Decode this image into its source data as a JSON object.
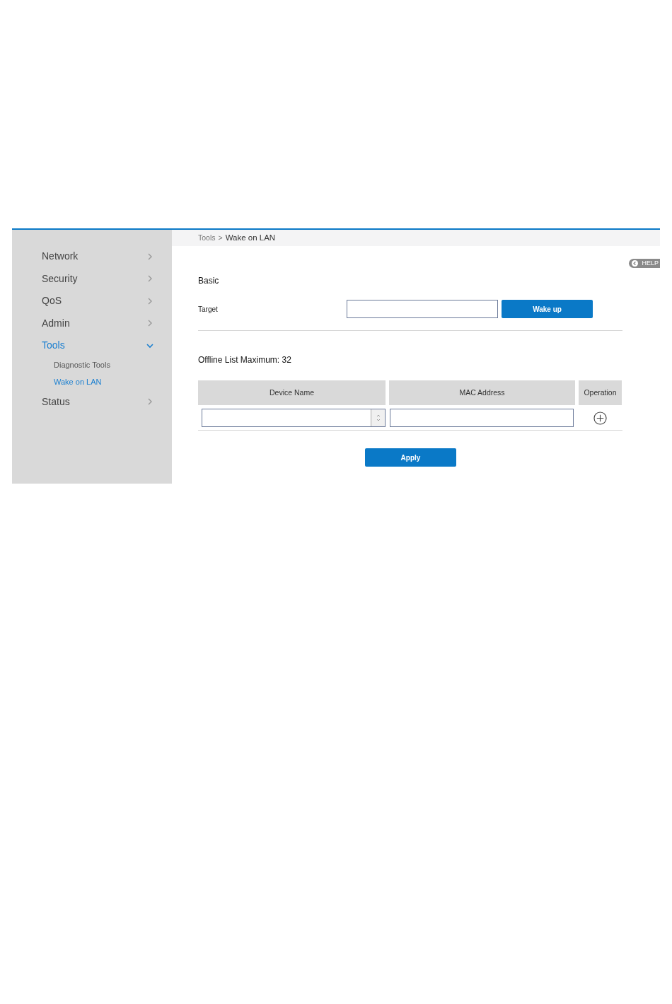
{
  "sidebar": {
    "items": [
      {
        "label": "Network",
        "expanded": false,
        "selected": false
      },
      {
        "label": "Security",
        "expanded": false,
        "selected": false
      },
      {
        "label": "QoS",
        "expanded": false,
        "selected": false
      },
      {
        "label": "Admin",
        "expanded": false,
        "selected": false
      },
      {
        "label": "Tools",
        "expanded": true,
        "selected": true,
        "children": [
          {
            "label": "Diagnostic Tools",
            "selected": false
          },
          {
            "label": "Wake on LAN",
            "selected": true
          }
        ]
      },
      {
        "label": "Status",
        "expanded": false,
        "selected": false
      }
    ]
  },
  "breadcrumb": {
    "parent": "Tools",
    "separator": ">",
    "current": "Wake on LAN"
  },
  "help_button": "HELP",
  "basic": {
    "title": "Basic",
    "target_label": "Target",
    "wake_button": "Wake up"
  },
  "offline_list": {
    "title": "Offline List Maximum: 32",
    "columns": [
      "Device Name",
      "MAC Address",
      "Operation"
    ]
  },
  "apply_button": "Apply"
}
